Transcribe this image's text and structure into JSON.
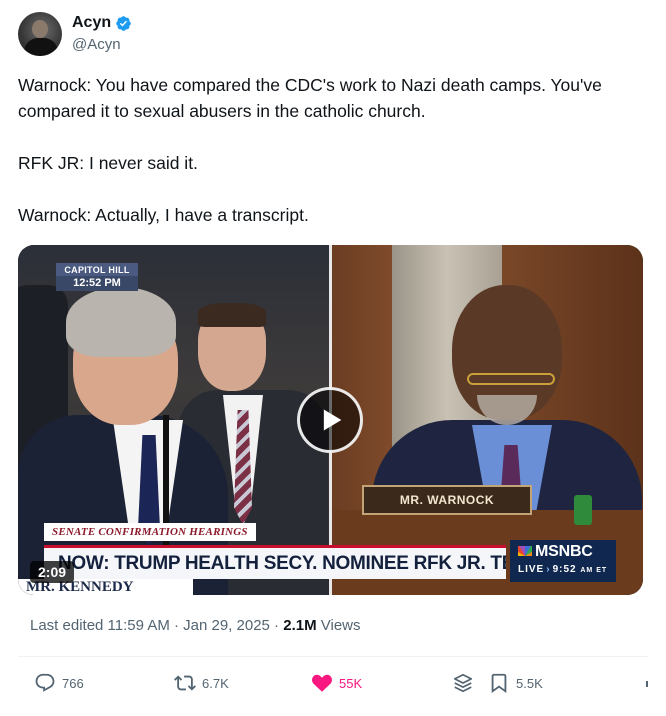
{
  "author": {
    "display_name": "Acyn",
    "handle": "@Acyn",
    "verified": true
  },
  "tweet": {
    "paragraphs": [
      "Warnock: You have compared the CDC's work to Nazi death camps. You've compared it to sexual abusers in the catholic church.",
      "RFK JR: I never said it.",
      "Warnock: Actually, I have a transcript."
    ]
  },
  "video": {
    "duration": "2:09",
    "capitol_badge_top": "CAPITOL HILL",
    "capitol_badge_time": "12:52 PM",
    "nameplate": "MR. WARNOCK",
    "lower_third_sub": "SENATE CONFIRMATION HEARINGS",
    "lower_third_main": "NOW: TRUMP HEALTH SECY. NOMINEE RFK JR. TESTIFIES",
    "lower_name": "MR. KENNEDY",
    "network": "MSNBC",
    "live_label": "LIVE",
    "live_time": "9:52",
    "live_ampm": "AM ET"
  },
  "meta": {
    "edited": "Last edited 11:59 AM · Jan 29, 2025 · ",
    "views_count": "2.1M",
    "views_label": " Views"
  },
  "actions": {
    "replies": "766",
    "reposts": "6.7K",
    "likes": "55K",
    "bookmarks": "5.5K"
  },
  "colors": {
    "like_active": "#f91880",
    "verified_blue": "#1d9bf0",
    "secondary_text": "#536471"
  }
}
